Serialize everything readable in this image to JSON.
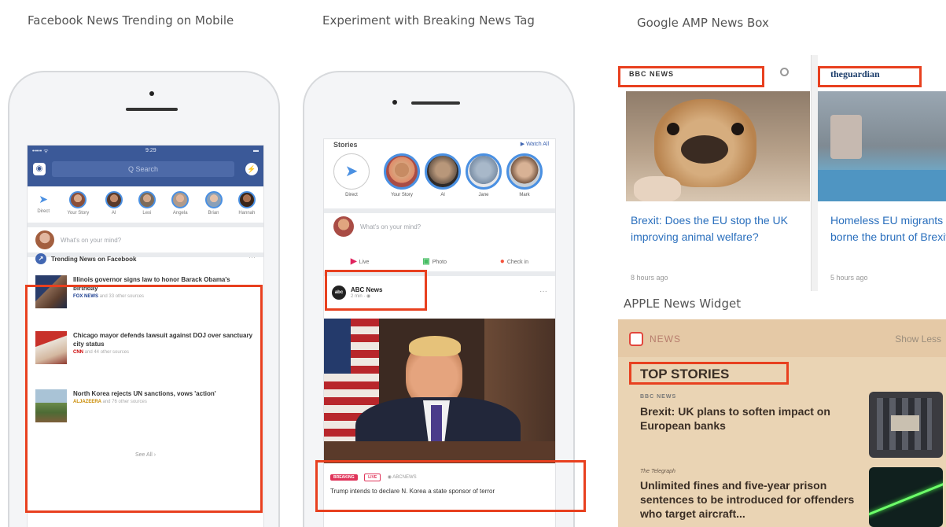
{
  "captions": {
    "facebook": "Facebook News Trending on Mobile",
    "breaking": "Experiment with Breaking News Tag",
    "amp": "Google AMP News Box",
    "apple": "APPLE News Widget"
  },
  "phone1": {
    "status_left": "••••• ᯤ",
    "status_time": "9:29",
    "status_battery": "▬",
    "search_placeholder": "Q Search",
    "stories": [
      "Direct",
      "Your Story",
      "Al",
      "Lexi",
      "Angela",
      "Brian",
      "Hannah"
    ],
    "composer_placeholder": "What's on your mind?",
    "trending_title": "Trending News on Facebook",
    "news_items": [
      {
        "headline": "Illinois governor signs law to honor Barack Obama's birthday",
        "source": "FOX NEWS",
        "more": "and 33 other sources"
      },
      {
        "headline": "Chicago mayor defends lawsuit against DOJ over sanctuary city status",
        "source": "CNN",
        "more": "and 44 other sources"
      },
      {
        "headline": "North Korea rejects UN sanctions, vows 'action'",
        "source": "ALJAZEERA",
        "more": "and 76 other sources"
      }
    ],
    "see_all": "See All ›"
  },
  "phone2": {
    "stories_label": "Stories",
    "stories_right": "▶ Watch All",
    "stories": [
      "Direct",
      "Your Story",
      "Al",
      "Jane",
      "Mark"
    ],
    "composer_placeholder": "What's on your mind?",
    "actions": [
      "Live",
      "Photo",
      "Check in"
    ],
    "page_name": "ABC News",
    "page_time": "2 min · ◉",
    "page_logo": "abc",
    "more_dots": "···",
    "tag_breaking": "BREAKING",
    "tag_live": "LIVE",
    "tag_source": "◉ ABCNEWS",
    "headline": "Trump intends to declare N. Korea a state sponsor of terror"
  },
  "amp": {
    "card1_logo": "BBC NEWS",
    "card2_logo": "theguardian",
    "card1_title": "Brexit: Does the EU stop the UK improving animal welfare?",
    "card1_time": "8 hours ago",
    "card2_title": "Homeless EU migrants have already borne the brunt of Brexit Britain",
    "card2_time": "5 hours ago"
  },
  "apple": {
    "app_label": "NEWS",
    "show_less": "Show Less",
    "section": "TOP STORIES",
    "story1_source": "BBC NEWS",
    "story1_title": "Brexit: UK plans to soften impact on European banks",
    "story2_source": "The Telegraph",
    "story2_title": "Unlimited fines and five-year prison sentences to be introduced for offenders who target aircraft..."
  },
  "colors": {
    "highlight": "#e8401f",
    "facebook_blue": "#3b5998",
    "link_blue": "#2a6fbd"
  }
}
